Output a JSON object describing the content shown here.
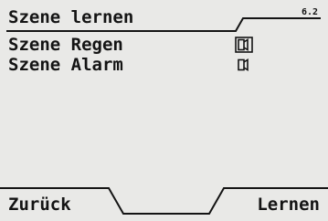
{
  "header": {
    "title": "Szene lernen",
    "version": "6.2"
  },
  "menu": {
    "items": [
      {
        "label": "Szene Regen",
        "icon": "scene-learn-icon",
        "selected": true
      },
      {
        "label": "Szene Alarm",
        "icon": "scene-learn-icon",
        "selected": false
      }
    ]
  },
  "softkeys": {
    "left": "Zurück",
    "right": "Lernen"
  }
}
